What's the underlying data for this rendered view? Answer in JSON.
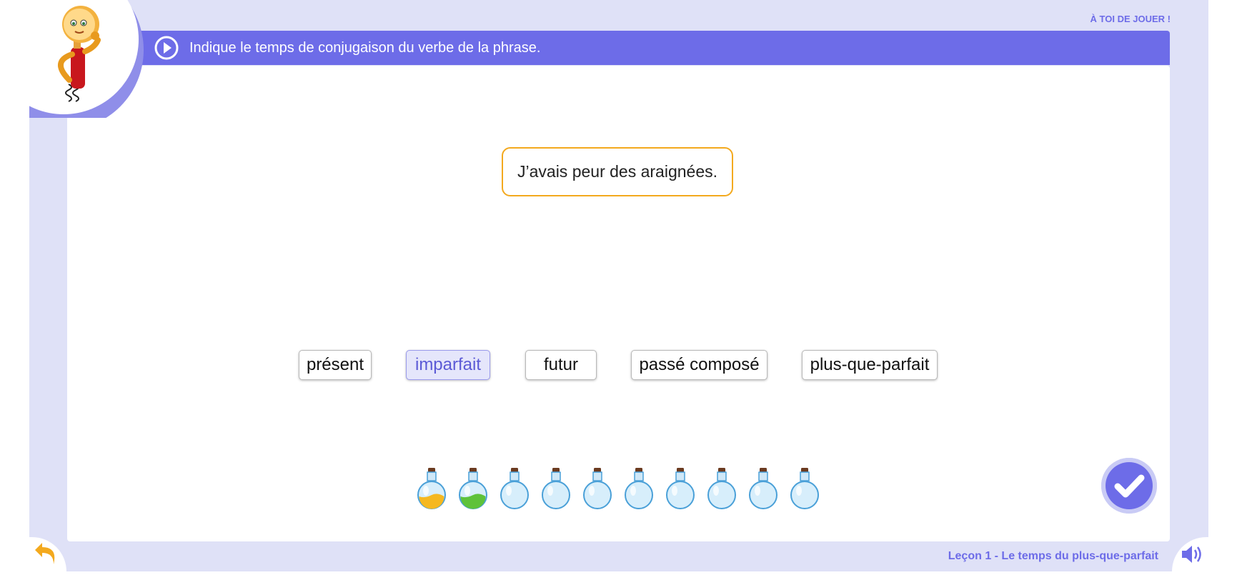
{
  "header": {
    "label": "À TOI DE JOUER !"
  },
  "instruction": {
    "text": "Indique le temps de conjugaison du verbe de la phrase.",
    "play_icon": "play-icon"
  },
  "sentence": {
    "text": "J’avais peur des araignées."
  },
  "choices": [
    {
      "label": "présent",
      "selected": false
    },
    {
      "label": "imparfait",
      "selected": true
    },
    {
      "label": "futur",
      "selected": false
    },
    {
      "label": "passé composé",
      "selected": false
    },
    {
      "label": "plus-que-parfait",
      "selected": false
    }
  ],
  "progress": {
    "total": 10,
    "flasks": [
      {
        "state": "filled",
        "liquid": "#f5b820"
      },
      {
        "state": "filled",
        "liquid": "#5ec23a"
      },
      {
        "state": "empty"
      },
      {
        "state": "empty"
      },
      {
        "state": "empty"
      },
      {
        "state": "empty"
      },
      {
        "state": "empty"
      },
      {
        "state": "empty"
      },
      {
        "state": "empty"
      },
      {
        "state": "empty"
      }
    ]
  },
  "footer": {
    "lesson": "Leçon 1 - Le temps du plus-que-parfait",
    "back_icon": "back-arrow-icon",
    "sound_icon": "speaker-icon",
    "validate_icon": "checkmark-icon"
  },
  "colors": {
    "accent": "#6d6ce8",
    "frame": "#dfe1f7",
    "sentence_border": "#f3a91e",
    "back_arrow": "#f3a91e"
  }
}
